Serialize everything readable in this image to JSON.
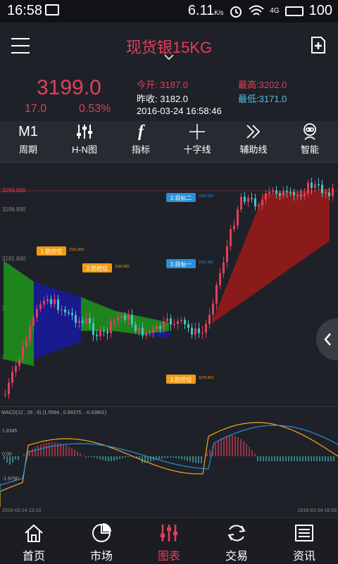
{
  "status": {
    "time": "16:58",
    "speed": "6.11",
    "speed_unit": "K/s",
    "network": "4G",
    "battery": "100"
  },
  "header": {
    "title": "现货银15KG"
  },
  "quote": {
    "price": "3199.0",
    "change": "17.0",
    "change_pct": "0.53%",
    "open_label": "今开:",
    "open": "3187.0",
    "prev_label": "昨收:",
    "prev": "3182.0",
    "high_label": "最高:",
    "high": "3202.0",
    "low_label": "最低:",
    "low": "3171.0",
    "datetime": "2016-03-24 16:58:46"
  },
  "toolbar": [
    {
      "label": "周期",
      "icon": "M1",
      "icon_name": "period-icon"
    },
    {
      "label": "H-N图",
      "icon_name": "sliders-icon"
    },
    {
      "label": "指标",
      "icon": "f",
      "icon_name": "indicator-icon"
    },
    {
      "label": "十字线",
      "icon_name": "crosshair-icon"
    },
    {
      "label": "辅助线",
      "icon_name": "guideline-icon"
    },
    {
      "label": "智能",
      "icon_name": "robot-icon"
    }
  ],
  "chart_data": {
    "type": "line",
    "price_labels": [
      "3199.000",
      "3196.800",
      "3191.600",
      "3186.400",
      "3181.200"
    ],
    "tags": [
      {
        "text": "1.防控位",
        "value": "3191.500"
      },
      {
        "text": "2.防控位",
        "value": "3190.865"
      },
      {
        "text": "3.目标二",
        "value": "3198.235"
      },
      {
        "text": "3.目标一",
        "value": "3191.305"
      },
      {
        "text": "3.防控位",
        "value": "3179.353"
      }
    ],
    "macd_label": "MACD(12 , 26 , 9) (1.5584 , 0.99375 , -0.43801)",
    "macd_ticks": [
      "1.8345",
      "0.00",
      "-1.9790"
    ],
    "x_start": "2016-03-24 15:10",
    "x_end": "2016-03-24 16:59",
    "colors": {
      "up": "#e0405a",
      "down": "#45c4c8",
      "green_band": "#1d8a1d",
      "blue_band": "#1a1a8f",
      "red_band": "#8b1a1a"
    }
  },
  "nav": [
    {
      "label": "首页",
      "icon_name": "home-icon"
    },
    {
      "label": "市场",
      "icon_name": "pie-chart-icon"
    },
    {
      "label": "图表",
      "icon_name": "chart-icon"
    },
    {
      "label": "交易",
      "icon_name": "exchange-icon"
    },
    {
      "label": "资讯",
      "icon_name": "news-icon"
    }
  ]
}
